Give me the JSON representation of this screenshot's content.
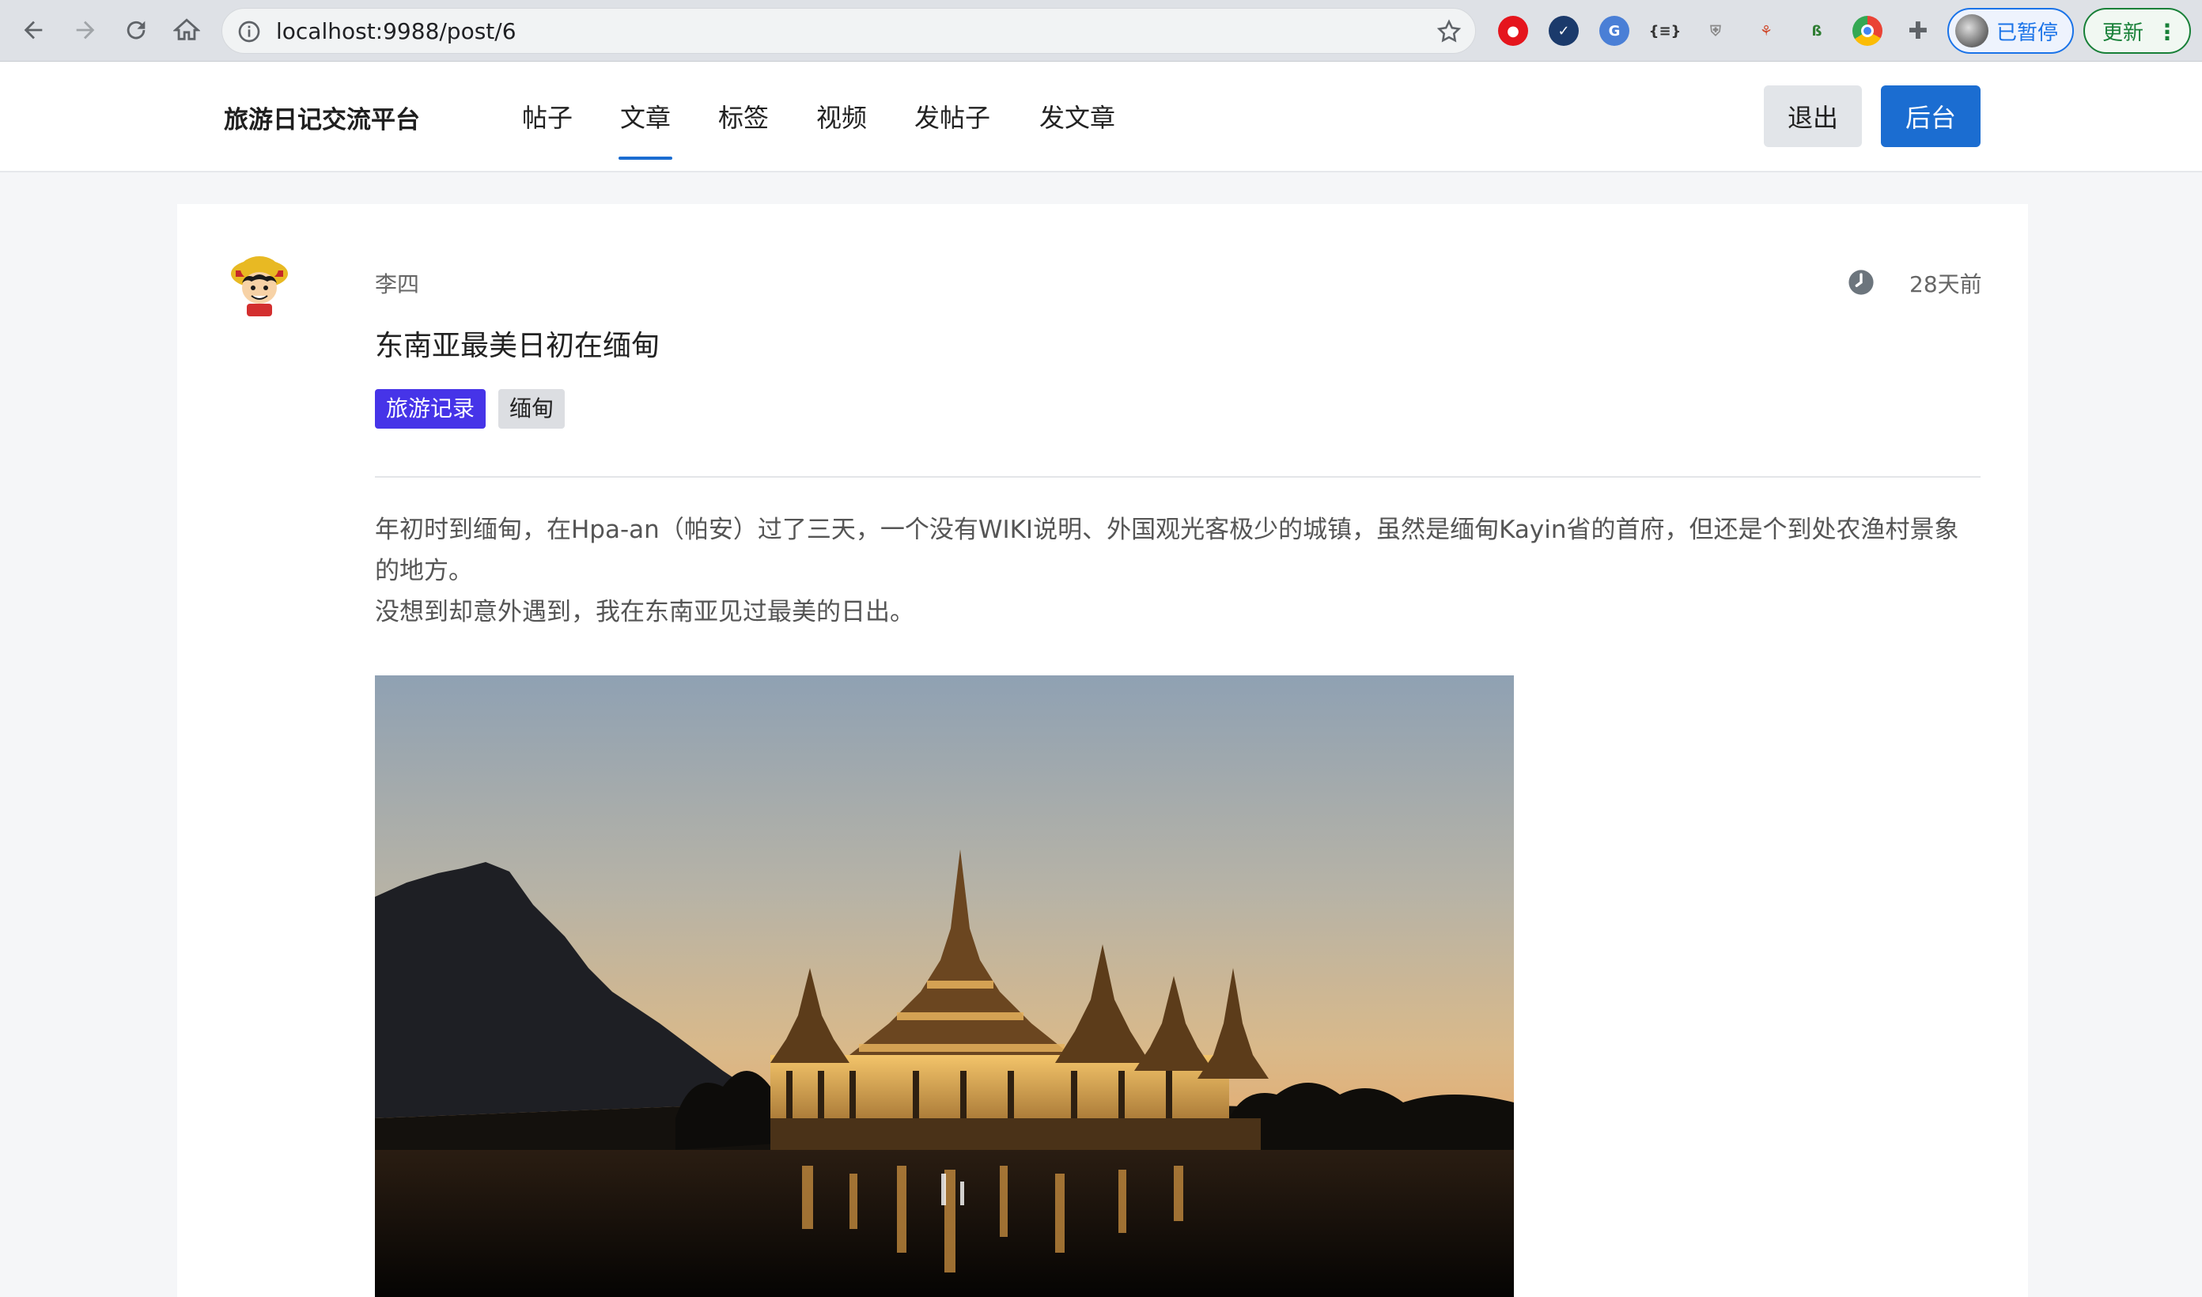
{
  "browser": {
    "url": "localhost:9988/post/6",
    "profile_label": "已暂停",
    "update_label": "更新"
  },
  "header": {
    "brand": "旅游日记交流平台",
    "nav": [
      "帖子",
      "文章",
      "标签",
      "视频",
      "发帖子",
      "发文章"
    ],
    "active_nav": "文章",
    "logout_label": "退出",
    "admin_label": "后台"
  },
  "post": {
    "author": "李四",
    "time_ago": "28天前",
    "title": "东南亚最美日初在缅甸",
    "tags": [
      "旅游记录",
      "缅甸"
    ],
    "paragraphs": [
      "年初时到缅甸，在Hpa-an（帕安）过了三天，一个没有WIKI说明、外国观光客极少的城镇，虽然是缅甸Kayin省的首府，但还是个到处农渔村景象的地方。",
      "没想到却意外遇到，我在东南亚见过最美的日出。"
    ]
  },
  "colors": {
    "primary": "#1b6dd1",
    "tag_primary": "#4634e8",
    "tag_secondary": "#dcdee2"
  }
}
